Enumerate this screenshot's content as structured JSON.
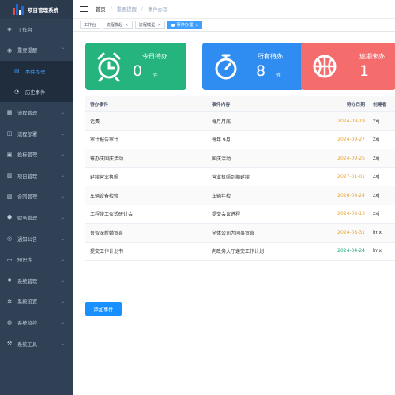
{
  "app": {
    "title": "项目管理系统",
    "logo_colors": [
      "#1e6bd6",
      "#e74c3c",
      "#ffffff"
    ]
  },
  "sidebar": {
    "items": [
      {
        "label": "工作台",
        "icon": "dashboard-icon",
        "expandable": false
      },
      {
        "label": "重要提醒",
        "icon": "bell-icon",
        "expandable": true,
        "expanded": true,
        "children": [
          {
            "label": "事件办理",
            "icon": "document-icon",
            "active": true
          },
          {
            "label": "历史事件",
            "icon": "clock-icon",
            "active": false
          }
        ]
      },
      {
        "label": "流程管理",
        "icon": "process-icon",
        "expandable": true
      },
      {
        "label": "流程部署",
        "icon": "deploy-icon",
        "expandable": true
      },
      {
        "label": "投标管理",
        "icon": "bid-icon",
        "expandable": true
      },
      {
        "label": "项目管理",
        "icon": "project-icon",
        "expandable": true
      },
      {
        "label": "合同管理",
        "icon": "contract-icon",
        "expandable": true
      },
      {
        "label": "财务管理",
        "icon": "finance-icon",
        "expandable": true
      },
      {
        "label": "通知公告",
        "icon": "notice-icon",
        "expandable": true
      },
      {
        "label": "知识库",
        "icon": "book-icon",
        "expandable": true
      },
      {
        "label": "系统管理",
        "icon": "gear-icon",
        "expandable": true
      },
      {
        "label": "系统设置",
        "icon": "settings-icon",
        "expandable": true
      },
      {
        "label": "系统监控",
        "icon": "monitor-icon",
        "expandable": true
      },
      {
        "label": "系统工具",
        "icon": "tool-icon",
        "expandable": true
      }
    ]
  },
  "header": {
    "breadcrumb": [
      "首页",
      "重要提醒",
      "事件办理"
    ]
  },
  "tags": [
    {
      "label": "工作台",
      "closable": false,
      "active": false
    },
    {
      "label": "流程发起",
      "closable": true,
      "active": false
    },
    {
      "label": "流程模型",
      "closable": true,
      "active": false
    },
    {
      "label": "事件办理",
      "closable": true,
      "active": true
    }
  ],
  "cards": [
    {
      "label": "今日待办",
      "value": "0",
      "unit": "件",
      "color": "#25b37e",
      "icon": "alarm-clock-icon"
    },
    {
      "label": "所有待办",
      "value": "8",
      "unit": "件",
      "color": "#2f8cf0",
      "icon": "stopwatch-icon"
    },
    {
      "label": "逾期未办",
      "value": "1",
      "unit": "",
      "color": "#f56c6c",
      "icon": "basketball-icon"
    }
  ],
  "table": {
    "headers": [
      "待办事件",
      "事件内容",
      "待办日期",
      "创建者"
    ],
    "rows": [
      {
        "event": "话费",
        "content": "每月月底",
        "date": "2024-09-19",
        "date_color": "orange",
        "creator": "zxj"
      },
      {
        "event": "审计报告审计",
        "content": "每年 9月",
        "date": "2024-09-27",
        "date_color": "orange",
        "creator": "zxj"
      },
      {
        "event": "筹办庆国庆活动",
        "content": "国庆活动",
        "date": "2024-09-25",
        "date_color": "orange",
        "creator": "zxj"
      },
      {
        "event": "延续营业执照",
        "content": "营业执照到期延续",
        "date": "2027-01-01",
        "date_color": "orange",
        "creator": "zxj"
      },
      {
        "event": "车辆设备检修",
        "content": "车辆年检",
        "date": "2026-08-24",
        "date_color": "orange",
        "creator": "zxj"
      },
      {
        "event": "工程竣工仪式研讨会",
        "content": "提交会议进程",
        "date": "2024-09-13",
        "date_color": "orange",
        "creator": "zxj"
      },
      {
        "event": "鲁智深新婚贺喜",
        "content": "全体公司为同事贺喜",
        "date": "2024-08-31",
        "date_color": "orange",
        "creator": "lmx"
      },
      {
        "event": "提交工作计划书",
        "content": "向政务大厅递交工作计划",
        "date": "2024-04-24",
        "date_color": "green",
        "creator": "lmx"
      }
    ]
  },
  "actions": {
    "add_label": "添加事件"
  }
}
